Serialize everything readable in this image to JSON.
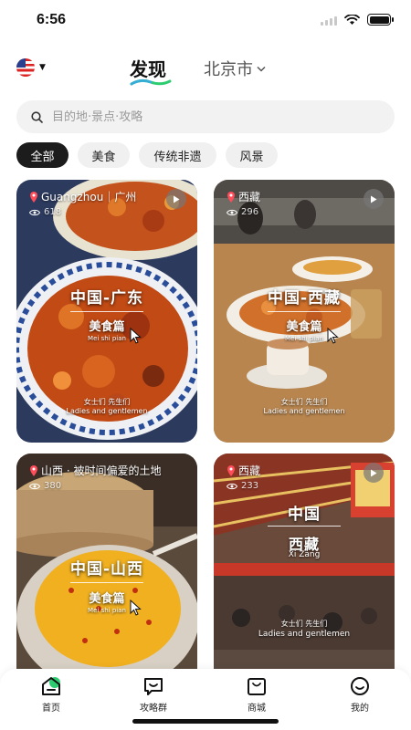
{
  "status_bar": {
    "time": "6:56"
  },
  "header": {
    "tab_discover": "发现",
    "tab_city": "北京市"
  },
  "search": {
    "placeholder": "目的地·景点·攻略"
  },
  "categories": [
    "全部",
    "美食",
    "传统非遗",
    "风景"
  ],
  "cards": [
    {
      "location": "Guangzhou｜广州",
      "views": "618",
      "title": "中国-广东",
      "subtitle": "美食篇",
      "pinyin": "Mei shi pian",
      "footer_cn": "女士们 先生们",
      "footer_en": "Ladies and gentlemen"
    },
    {
      "location": "西藏",
      "views": "296",
      "title": "中国-西藏",
      "subtitle": "美食篇",
      "pinyin": "Mei shi pian",
      "footer_cn": "女士们 先生们",
      "footer_en": "Ladies and gentlemen"
    },
    {
      "location": "山西 · 被时间偏爱的土地",
      "views": "380",
      "title": "中国-山西",
      "subtitle": "美食篇",
      "pinyin": "Mei shi pian"
    },
    {
      "location": "西藏",
      "views": "233",
      "title": "中国",
      "subtitle": "西藏",
      "pinyin": "Xi Zang",
      "footer_cn": "女士们 先生们",
      "footer_en": "Ladies and gentlemen"
    }
  ],
  "tabbar": {
    "home": "首页",
    "guides": "攻略群",
    "mall": "商城",
    "me": "我的"
  },
  "colors": {
    "accent_green": "#2ecc71",
    "accent_blue": "#3aa0ff",
    "chip_active": "#1c1c1c"
  },
  "icons": [
    "pin-icon",
    "eye-icon",
    "play-icon",
    "search-icon",
    "home-icon",
    "chat-icon",
    "shop-icon",
    "smile-icon"
  ]
}
